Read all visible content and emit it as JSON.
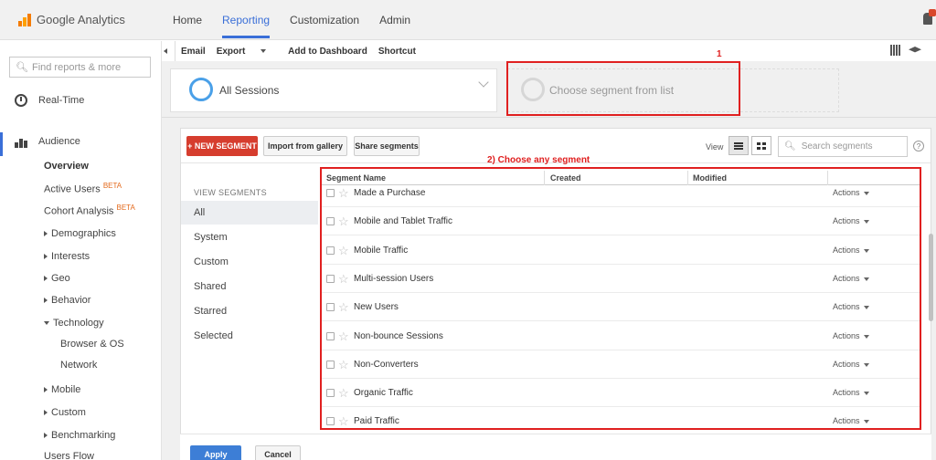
{
  "app": {
    "logo_text": "Google Analytics"
  },
  "nav": [
    "Home",
    "Reporting",
    "Customization",
    "Admin"
  ],
  "sidebar": {
    "search_placeholder": "Find reports & more",
    "realtime": "Real-Time",
    "audience": "Audience",
    "overview": "Overview",
    "active_users": "Active Users",
    "cohort": "Cohort Analysis",
    "beta": "BETA",
    "demographics": "Demographics",
    "interests": "Interests",
    "geo": "Geo",
    "behavior": "Behavior",
    "technology": "Technology",
    "browser_os": "Browser & OS",
    "network": "Network",
    "mobile": "Mobile",
    "custom": "Custom",
    "benchmarking": "Benchmarking",
    "users_flow": "Users Flow"
  },
  "toolbar": {
    "email": "Email",
    "export": "Export",
    "add_dashboard": "Add to Dashboard",
    "shortcut": "Shortcut"
  },
  "segments": {
    "active": "All Sessions",
    "choose": "Choose segment from list",
    "annotation1": "1",
    "annotation2": "2) Choose any segment",
    "new_btn": "+ NEW SEGMENT",
    "import_btn": "Import from gallery",
    "share_btn": "Share segments",
    "view_label": "View",
    "search_placeholder": "Search segments",
    "help": "?",
    "menu_title": "VIEW SEGMENTS",
    "menu": [
      "All",
      "System",
      "Custom",
      "Shared",
      "Starred",
      "Selected"
    ],
    "columns": {
      "name": "Segment Name",
      "created": "Created",
      "modified": "Modified"
    },
    "action_label": "Actions",
    "rows": [
      "Made a Purchase",
      "Mobile and Tablet Traffic",
      "Mobile Traffic",
      "Multi-session Users",
      "New Users",
      "Non-bounce Sessions",
      "Non-Converters",
      "Organic Traffic",
      "Paid Traffic"
    ]
  },
  "footer": {
    "apply": "Apply",
    "cancel": "Cancel"
  },
  "colors": {
    "accent": "#3a6fd8",
    "new_segment": "#d63d2e",
    "annotation": "#e02020"
  }
}
